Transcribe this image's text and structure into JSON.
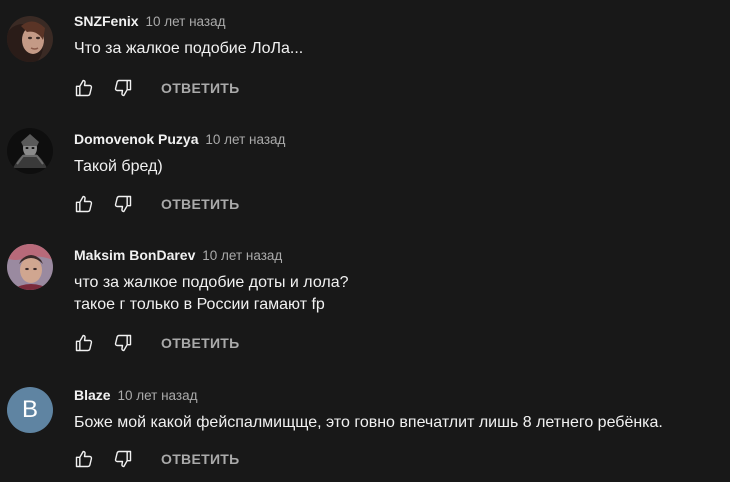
{
  "comments": [
    {
      "author": "SNZFenix",
      "time": "10 лет назад",
      "lines": [
        "Что за жалкое подобие ЛоЛа..."
      ],
      "reply_label": "ОТВЕТИТЬ",
      "avatar": {
        "kind": "photo",
        "colors": [
          "#3a2a24",
          "#c49a86",
          "#6b4636"
        ]
      }
    },
    {
      "author": "Domovenok Puzya",
      "time": "10 лет назад",
      "lines": [
        "Такой бред)"
      ],
      "reply_label": "ОТВЕТИТЬ",
      "avatar": {
        "kind": "photo",
        "colors": [
          "#0e0e0e",
          "#8a8a8a",
          "#4a4a4a"
        ]
      }
    },
    {
      "author": "Maksim BonDarev",
      "time": "10 лет назад",
      "lines": [
        "что за жалкое подобие доты и лола?",
        "такое г только в России гамают fp"
      ],
      "reply_label": "ОТВЕТИТЬ",
      "avatar": {
        "kind": "photo",
        "colors": [
          "#9a8aa0",
          "#7a2a3a",
          "#d0a690"
        ]
      }
    },
    {
      "author": "Blaze",
      "time": "10 лет назад",
      "lines": [
        "Боже мой какой фейспалмищще, это говно впечатлит лишь 8 летнего ребёнка."
      ],
      "reply_label": "ОТВЕТИТЬ",
      "avatar": {
        "kind": "letter",
        "letter": "B",
        "color": "#5f84a2"
      }
    }
  ]
}
